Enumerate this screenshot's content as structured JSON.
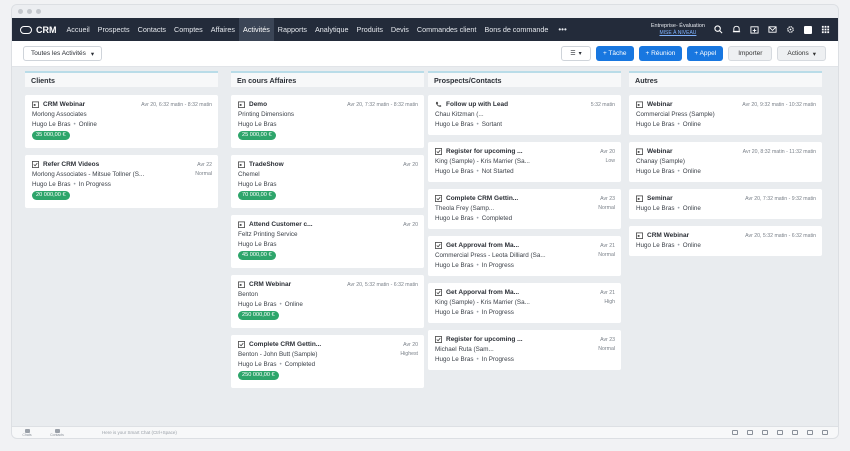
{
  "app": {
    "name": "CRM"
  },
  "nav": {
    "items": [
      "Accueil",
      "Prospects",
      "Contacts",
      "Comptes",
      "Affaires",
      "Activités",
      "Rapports",
      "Analytique",
      "Produits",
      "Devis",
      "Commandes client",
      "Bons de commande"
    ],
    "active": "Activités",
    "more": "•••"
  },
  "trial": {
    "line1": "Entreprise- Évaluation",
    "line2": "MISE À NIVEAU"
  },
  "toolbar": {
    "view_label": "Toutes les Activités",
    "task_label": "+ Tâche",
    "meeting_label": "+ Réunion",
    "call_label": "+ Appel",
    "import_label": "Importer",
    "actions_label": "Actions"
  },
  "columns": [
    {
      "title": "Clients",
      "cards": [
        {
          "icon": "event-icon",
          "title": "CRM Webinar",
          "date": "Avr 20, 6:32 matin - 8:32 matin",
          "line1": "Morlong Associates",
          "owner": "Hugo Le Bras",
          "status": "Online",
          "amount": "35 000,00 €",
          "priority": ""
        },
        {
          "icon": "task-icon",
          "title": "Refer CRM Videos",
          "date": "Avr 22",
          "line1": "Morlong Associates - Mitsue Tollner (S...",
          "owner": "Hugo Le Bras",
          "status": "In Progress",
          "amount": "20 000,00 €",
          "priority": "Normal"
        }
      ]
    },
    {
      "title": "En cours Affaires",
      "cards": [
        {
          "icon": "event-icon",
          "title": "Demo",
          "date": "Avr 20, 7:32 matin - 8:32 matin",
          "line1": "Printing Dimensions",
          "owner": "Hugo Le Bras",
          "status": "",
          "amount": "25 000,00 €",
          "priority": ""
        },
        {
          "icon": "event-icon",
          "title": "TradeShow",
          "date": "Avr 20",
          "line1": "Chemel",
          "owner": "Hugo Le Bras",
          "status": "",
          "amount": "70 000,00 €",
          "priority": ""
        },
        {
          "icon": "event-icon",
          "title": "Attend Customer c...",
          "date": "Avr 20",
          "line1": "Feltz Printing Service",
          "owner": "Hugo Le Bras",
          "status": "",
          "amount": "45 000,00 €",
          "priority": ""
        },
        {
          "icon": "event-icon",
          "title": "CRM Webinar",
          "date": "Avr 20, 5:32 matin - 6:32 matin",
          "line1": "Benton",
          "owner": "Hugo Le Bras",
          "status": "Online",
          "amount": "250 000,00 €",
          "priority": ""
        },
        {
          "icon": "task-icon",
          "title": "Complete CRM Gettin...",
          "date": "Avr 20",
          "line1": "Benton - John Butt (Sample)",
          "owner": "Hugo Le Bras",
          "status": "Completed",
          "amount": "250 000,00 €",
          "priority": "Highest"
        }
      ]
    },
    {
      "title": "Prospects/Contacts",
      "cards": [
        {
          "icon": "phone-icon",
          "title": "Follow up with Lead",
          "date": "5:32 matin",
          "line1": "Chau Kitzman (...",
          "owner": "Hugo Le Bras",
          "status": "Sortant",
          "amount": "",
          "priority": ""
        },
        {
          "icon": "task-icon",
          "title": "Register for upcoming ...",
          "date": "Avr 20",
          "line1": "King (Sample) - Kris Marrier (Sa...",
          "owner": "Hugo Le Bras",
          "status": "Not Started",
          "amount": "",
          "priority": "Low"
        },
        {
          "icon": "task-icon",
          "title": "Complete CRM Gettin...",
          "date": "Avr 23",
          "line1": "Theola Frey (Samp...",
          "owner": "Hugo Le Bras",
          "status": "Completed",
          "amount": "",
          "priority": "Normal"
        },
        {
          "icon": "task-icon",
          "title": "Get Approval from Ma...",
          "date": "Avr 21",
          "line1": "Commercial Press - Leota Dilliard (Sa...",
          "owner": "Hugo Le Bras",
          "status": "In Progress",
          "amount": "",
          "priority": "Normal"
        },
        {
          "icon": "task-icon",
          "title": "Get Apporval from Ma...",
          "date": "Avr 21",
          "line1": "King (Sample) - Kris Marrier (Sa...",
          "owner": "Hugo Le Bras",
          "status": "In Progress",
          "amount": "",
          "priority": "High"
        },
        {
          "icon": "task-icon",
          "title": "Register for upcoming ...",
          "date": "Avr 23",
          "line1": "Michael Ruta (Sam...",
          "owner": "Hugo Le Bras",
          "status": "In Progress",
          "amount": "",
          "priority": "Normal"
        }
      ]
    },
    {
      "title": "Autres",
      "cards": [
        {
          "icon": "event-icon",
          "title": "Webinar",
          "date": "Avr 20, 9:32 matin - 10:32 matin",
          "line1": "Commercial Press (Sample)",
          "owner": "Hugo Le Bras",
          "status": "Online",
          "amount": "",
          "priority": ""
        },
        {
          "icon": "event-icon",
          "title": "Webinar",
          "date": "Avr 20, 8:32 matin - 11:32 matin",
          "line1": "Chanay (Sample)",
          "owner": "Hugo Le Bras",
          "status": "Online",
          "amount": "",
          "priority": ""
        },
        {
          "icon": "event-icon",
          "title": "Seminar",
          "date": "Avr 20, 7:32 matin - 9:32 matin",
          "line1": "",
          "owner": "Hugo Le Bras",
          "status": "Online",
          "amount": "",
          "priority": ""
        },
        {
          "icon": "event-icon",
          "title": "CRM Webinar",
          "date": "Avr 20, 5:32 matin - 6:32 matin",
          "line1": "",
          "owner": "Hugo Le Bras",
          "status": "Online",
          "amount": "",
          "priority": ""
        }
      ]
    }
  ],
  "bottombar": {
    "chats": "Chats",
    "contacts": "Contacts",
    "search_placeholder": "Here is your Smart Chat (Ctrl+Space)"
  }
}
